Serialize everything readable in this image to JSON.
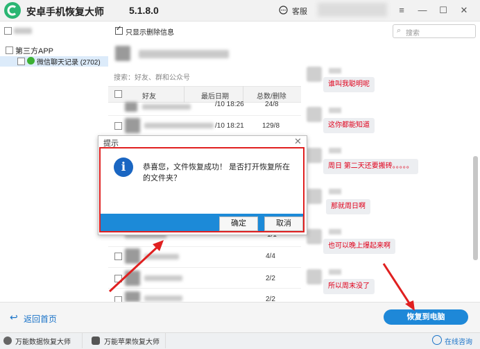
{
  "app": {
    "title": "安卓手机恢复大师",
    "version": "5.1.8.0",
    "service_label": "客服"
  },
  "tree": {
    "root_label": "第三方APP",
    "child_label": "微信聊天记录 (2702)"
  },
  "toolbar": {
    "only_deleted_label": "只显示删除信息",
    "search_placeholder": "搜索"
  },
  "middle": {
    "search_hint": "搜索：好友、群和公众号",
    "columns": [
      "好友",
      "最后日期",
      "总数/删除"
    ],
    "rows": [
      {
        "date": "/10 18:26",
        "count": "24/8"
      },
      {
        "date": "/10 18:21",
        "count": "129/8"
      },
      {
        "date": "",
        "count": "1/1"
      },
      {
        "date": "",
        "count": "4/4"
      },
      {
        "date": "",
        "count": "2/2"
      },
      {
        "date": "",
        "count": "2/2"
      }
    ]
  },
  "chat": {
    "messages": [
      "谁叫我聪明呢",
      "这你都能知道",
      "周日 第二天还要搬砖。。。。。",
      "那就周日啊",
      "也可以晚上爆起来啊",
      "所以周末没了"
    ]
  },
  "dialog": {
    "title": "提示",
    "message": "恭喜您，文件恢复成功！ 是否打开恢复所在的文件夹？",
    "ok_label": "确定",
    "cancel_label": "取消"
  },
  "bottom": {
    "back_label": "返回首页",
    "recover_label": "恢复到电脑"
  },
  "footer": {
    "tab1": "万能数据恢复大师",
    "tab2": "万能苹果恢复大师",
    "online_label": "在线咨询"
  },
  "colors": {
    "accent": "#1e88d8",
    "alert_red": "#e02020",
    "message_red": "#e0001b"
  }
}
